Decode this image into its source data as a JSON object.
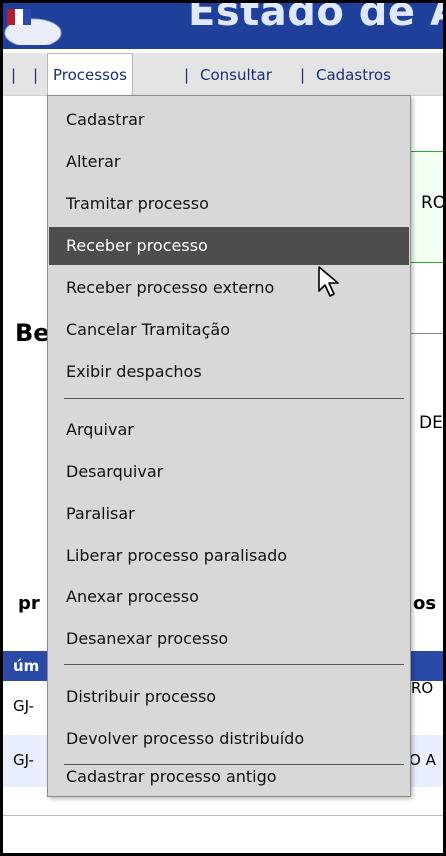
{
  "header": {
    "title": "Estado de A"
  },
  "nav": {
    "separator": "|",
    "items": [
      "Processos",
      "Consultar",
      "Cadastros"
    ]
  },
  "background": {
    "text_ro": "RO",
    "text_be": "Be",
    "text_de": "DE",
    "text_pr": "pr",
    "text_os": "os",
    "header_um": "úm",
    "row1_left": "GJ-",
    "row1_right": "RO",
    "row2_left": "GJ-",
    "row2_right": "O A"
  },
  "menu": {
    "group1": [
      "Cadastrar",
      "Alterar",
      "Tramitar processo",
      "Receber processo",
      "Receber processo externo",
      "Cancelar Tramitação",
      "Exibir despachos"
    ],
    "group2": [
      "Arquivar",
      "Desarquivar",
      "Paralisar",
      "Liberar processo paralisado",
      "Anexar processo",
      "Desanexar processo"
    ],
    "group3": [
      "Distribuir processo",
      "Devolver processo distribuído"
    ],
    "group4": [
      "Cadastrar processo antigo"
    ],
    "active_item": "Receber processo"
  },
  "colors": {
    "header_blue": "#1e3f9a",
    "menu_bg": "#d8d8d8",
    "menu_active_bg": "#4d4d4d",
    "link_blue": "#1a2f7a",
    "green_border": "#2faa2a"
  }
}
